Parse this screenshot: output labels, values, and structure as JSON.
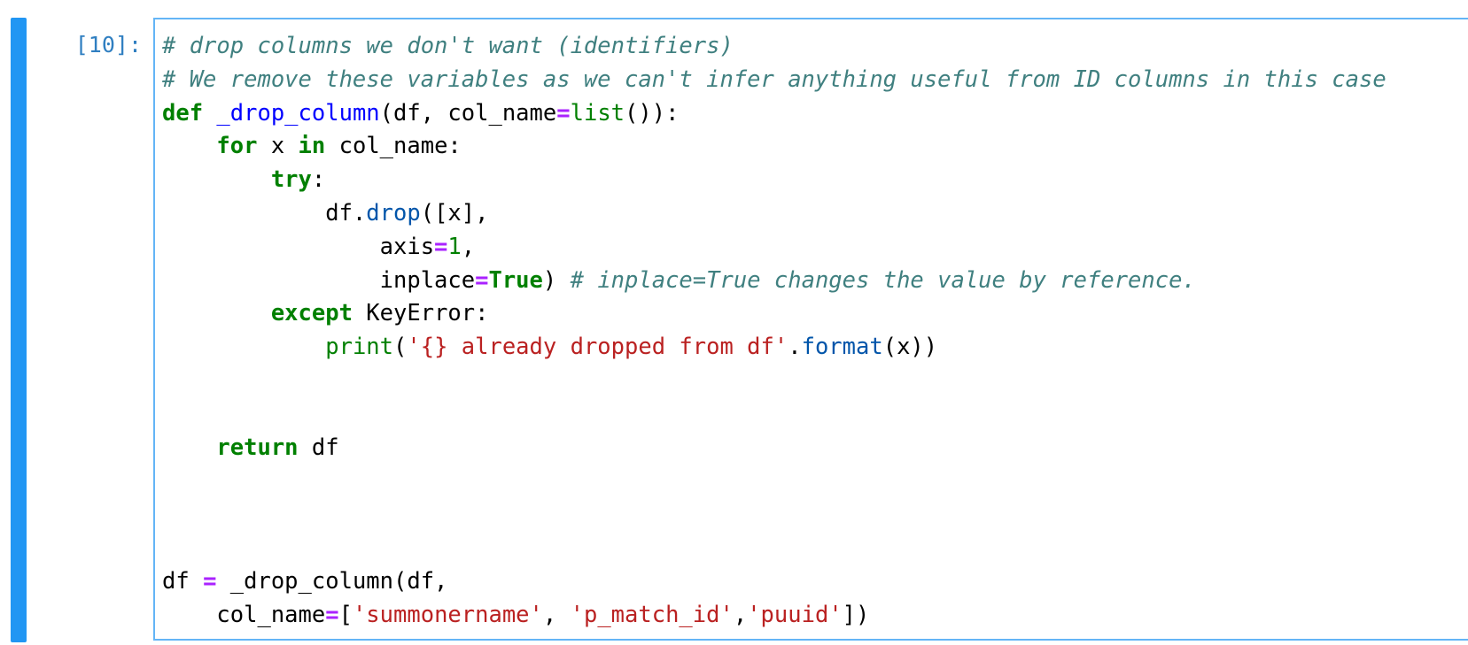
{
  "cell": {
    "prompt": "[10]:",
    "lines": [
      {
        "tokens": [
          {
            "t": "cm",
            "v": "# drop columns we don't want (identifiers)"
          }
        ]
      },
      {
        "tokens": [
          {
            "t": "cm",
            "v": "# We remove these variables as we can't infer anything useful from ID columns in this case"
          }
        ]
      },
      {
        "tokens": [
          {
            "t": "kw",
            "v": "def"
          },
          {
            "t": "",
            "v": " "
          },
          {
            "t": "fn",
            "v": "_drop_column"
          },
          {
            "t": "",
            "v": "(df, col_name"
          },
          {
            "t": "op",
            "v": "="
          },
          {
            "t": "bi",
            "v": "list"
          },
          {
            "t": "",
            "v": "()):"
          }
        ]
      },
      {
        "tokens": [
          {
            "t": "",
            "v": "    "
          },
          {
            "t": "kw",
            "v": "for"
          },
          {
            "t": "",
            "v": " x "
          },
          {
            "t": "kw",
            "v": "in"
          },
          {
            "t": "",
            "v": " col_name:"
          }
        ]
      },
      {
        "tokens": [
          {
            "t": "",
            "v": "        "
          },
          {
            "t": "kw",
            "v": "try"
          },
          {
            "t": "",
            "v": ":"
          }
        ]
      },
      {
        "tokens": [
          {
            "t": "",
            "v": "            df."
          },
          {
            "t": "mt",
            "v": "drop"
          },
          {
            "t": "",
            "v": "([x],"
          }
        ]
      },
      {
        "tokens": [
          {
            "t": "",
            "v": "                axis"
          },
          {
            "t": "op",
            "v": "="
          },
          {
            "t": "nm",
            "v": "1"
          },
          {
            "t": "",
            "v": ","
          }
        ]
      },
      {
        "tokens": [
          {
            "t": "",
            "v": "                inplace"
          },
          {
            "t": "op",
            "v": "="
          },
          {
            "t": "kw",
            "v": "True"
          },
          {
            "t": "",
            "v": ") "
          },
          {
            "t": "cm",
            "v": "# inplace=True changes the value by reference."
          }
        ]
      },
      {
        "tokens": [
          {
            "t": "",
            "v": "        "
          },
          {
            "t": "kw",
            "v": "except"
          },
          {
            "t": "",
            "v": " KeyError:"
          }
        ]
      },
      {
        "tokens": [
          {
            "t": "",
            "v": "            "
          },
          {
            "t": "bi",
            "v": "print"
          },
          {
            "t": "",
            "v": "("
          },
          {
            "t": "st",
            "v": "'{} already dropped from df'"
          },
          {
            "t": "",
            "v": "."
          },
          {
            "t": "mt",
            "v": "format"
          },
          {
            "t": "",
            "v": "(x))"
          }
        ]
      },
      {
        "tokens": []
      },
      {
        "tokens": []
      },
      {
        "tokens": [
          {
            "t": "",
            "v": "    "
          },
          {
            "t": "kw",
            "v": "return"
          },
          {
            "t": "",
            "v": " df"
          }
        ]
      },
      {
        "tokens": []
      },
      {
        "tokens": []
      },
      {
        "tokens": []
      },
      {
        "tokens": [
          {
            "t": "",
            "v": "df "
          },
          {
            "t": "op",
            "v": "="
          },
          {
            "t": "",
            "v": " _drop_column(df,"
          }
        ]
      },
      {
        "tokens": [
          {
            "t": "",
            "v": "    col_name"
          },
          {
            "t": "op",
            "v": "="
          },
          {
            "t": "",
            "v": "["
          },
          {
            "t": "st",
            "v": "'summonername'"
          },
          {
            "t": "",
            "v": ", "
          },
          {
            "t": "st",
            "v": "'p_match_id'"
          },
          {
            "t": "",
            "v": ","
          },
          {
            "t": "st",
            "v": "'puuid'"
          },
          {
            "t": "",
            "v": "])"
          }
        ]
      }
    ]
  },
  "colors": {
    "active_bar": "#2196f3",
    "editor_border": "#64b5f6",
    "prompt": "#307fc1"
  }
}
